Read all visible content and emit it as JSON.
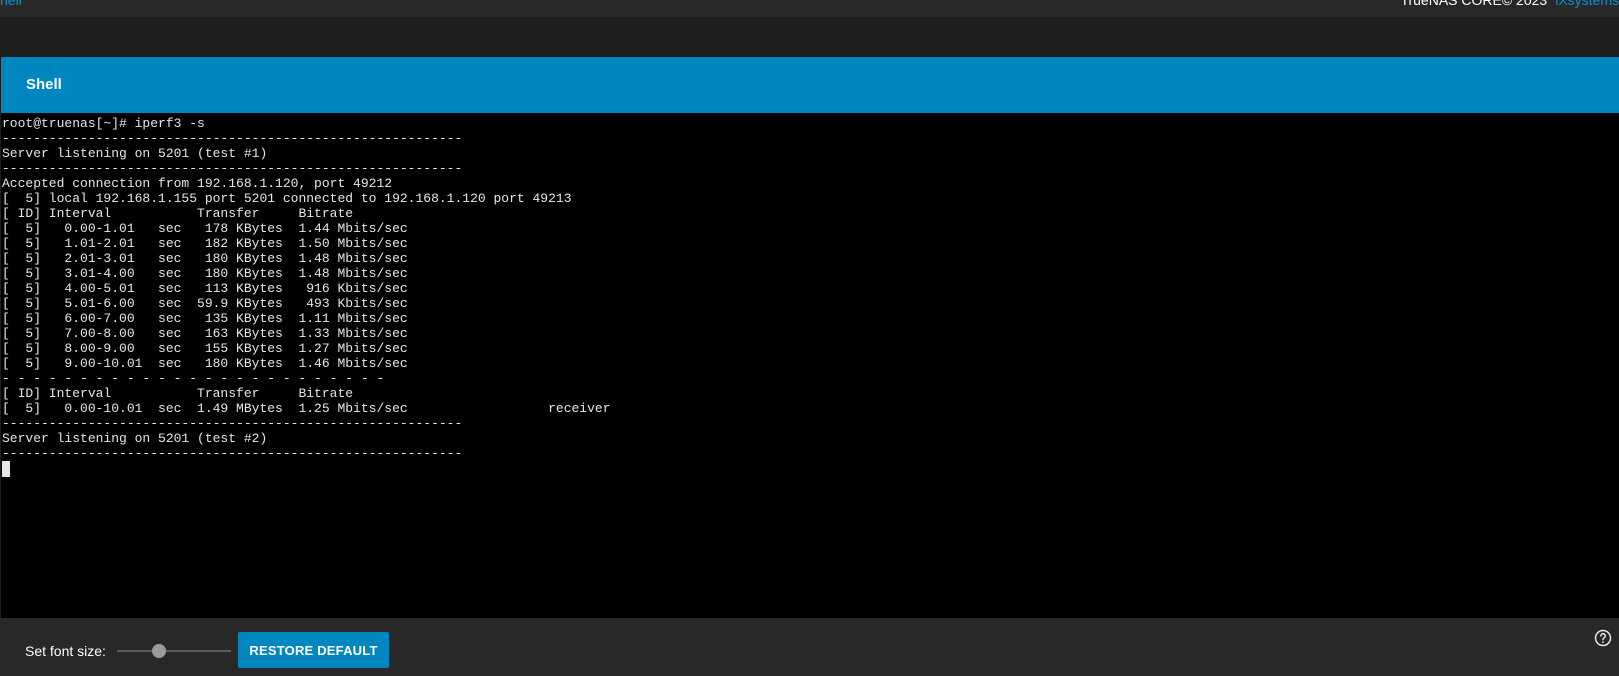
{
  "topbar": {
    "breadcrumb": "hell",
    "version": "TrueNAS CORE© 2023",
    "system": "iXsystems"
  },
  "panel": {
    "title": "Shell"
  },
  "terminal": {
    "output": "root@truenas[~]# iperf3 -s\n-----------------------------------------------------------\nServer listening on 5201 (test #1)\n-----------------------------------------------------------\nAccepted connection from 192.168.1.120, port 49212\n[  5] local 192.168.1.155 port 5201 connected to 192.168.1.120 port 49213\n[ ID] Interval           Transfer     Bitrate\n[  5]   0.00-1.01   sec   178 KBytes  1.44 Mbits/sec\n[  5]   1.01-2.01   sec   182 KBytes  1.50 Mbits/sec\n[  5]   2.01-3.01   sec   180 KBytes  1.48 Mbits/sec\n[  5]   3.01-4.00   sec   180 KBytes  1.48 Mbits/sec\n[  5]   4.00-5.01   sec   113 KBytes   916 Kbits/sec\n[  5]   5.01-6.00   sec  59.9 KBytes   493 Kbits/sec\n[  5]   6.00-7.00   sec   135 KBytes  1.11 Mbits/sec\n[  5]   7.00-8.00   sec   163 KBytes  1.33 Mbits/sec\n[  5]   8.00-9.00   sec   155 KBytes  1.27 Mbits/sec\n[  5]   9.00-10.01  sec   180 KBytes  1.46 Mbits/sec\n- - - - - - - - - - - - - - - - - - - - - - - - -\n[ ID] Interval           Transfer     Bitrate\n[  5]   0.00-10.01  sec  1.49 MBytes  1.25 Mbits/sec                  receiver\n-----------------------------------------------------------\nServer listening on 5201 (test #2)\n-----------------------------------------------------------"
  },
  "footer": {
    "font_size_label": "Set font size:",
    "font_size_value": 0.35,
    "restore_label": "RESTORE DEFAULT"
  },
  "icons": {
    "help": "help-circle-icon"
  },
  "colors": {
    "accent": "#0087c0",
    "terminal_bg": "#000000",
    "terminal_fg": "#e6e6e6",
    "chrome_bg": "#282828"
  }
}
